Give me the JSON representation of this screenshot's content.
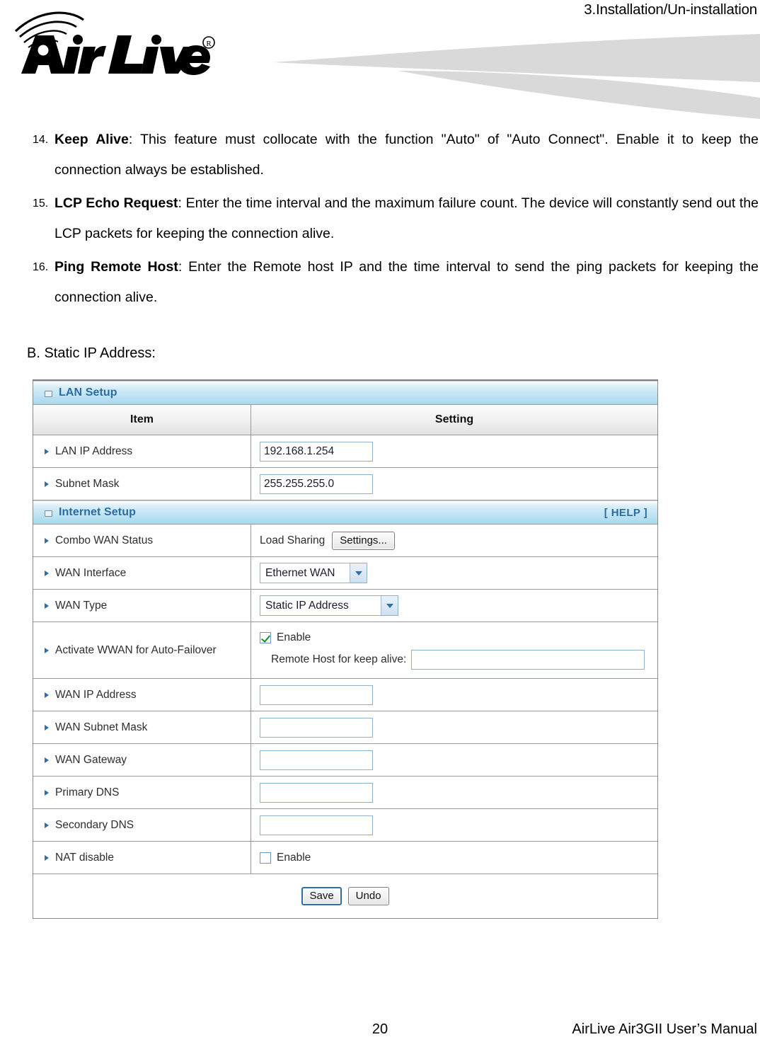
{
  "header": {
    "section_title": "3.Installation/Un-installation",
    "logo_text": "Air Live",
    "logo_registered": "®"
  },
  "body": {
    "items": [
      {
        "num": "14.",
        "term": "Keep Alive",
        "text": ": This feature must collocate with the function \"Auto\" of \"Auto Connect\". Enable it to keep the connection always be established."
      },
      {
        "num": "15.",
        "term": "LCP Echo Request",
        "text": ": Enter the time interval and the maximum failure count. The device will constantly send out the LCP packets for keeping the connection alive."
      },
      {
        "num": "16.",
        "term": "Ping Remote Host",
        "text": ": Enter the Remote host IP and the time interval to send the ping packets for keeping the connection alive."
      }
    ],
    "section_label": "B. Static IP Address:"
  },
  "router_ui": {
    "lan_section": {
      "title": "LAN Setup",
      "columns": {
        "item": "Item",
        "setting": "Setting"
      },
      "rows": [
        {
          "label": "LAN IP Address",
          "value": "192.168.1.254"
        },
        {
          "label": "Subnet Mask",
          "value": "255.255.255.0"
        }
      ]
    },
    "internet_section": {
      "title": "Internet Setup",
      "help_label": "[ HELP ]",
      "combo_wan_status": {
        "label": "Combo WAN Status",
        "mode_text": "Load Sharing",
        "settings_button": "Settings..."
      },
      "wan_interface": {
        "label": "WAN Interface",
        "selected": "Ethernet WAN"
      },
      "wan_type": {
        "label": "WAN Type",
        "selected": "Static IP Address"
      },
      "activate_wwan": {
        "label": "Activate WWAN for Auto-Failover",
        "enable_label": "Enable",
        "enable_checked": true,
        "remote_host_label": "Remote Host for keep alive:",
        "remote_host_value": ""
      },
      "fields": [
        {
          "label": "WAN IP Address",
          "value": ""
        },
        {
          "label": "WAN Subnet Mask",
          "value": ""
        },
        {
          "label": "WAN Gateway",
          "value": ""
        },
        {
          "label": "Primary DNS",
          "value": ""
        },
        {
          "label": "Secondary DNS",
          "value": ""
        }
      ],
      "nat_disable": {
        "label": "NAT disable",
        "enable_label": "Enable",
        "enable_checked": false
      },
      "buttons": {
        "save": "Save",
        "undo": "Undo"
      }
    }
  },
  "footer": {
    "page_number": "20",
    "manual_title": "AirLive Air3GII User’s Manual"
  },
  "colors": {
    "section_header_text": "#2b6ca3",
    "bullet_arrow": "#2f6fa8",
    "panel_border": "#8a8a8a",
    "input_border": "#8fb2cc",
    "check_green": "#1a8a2e",
    "banner_gray": "#d9d9d9"
  }
}
